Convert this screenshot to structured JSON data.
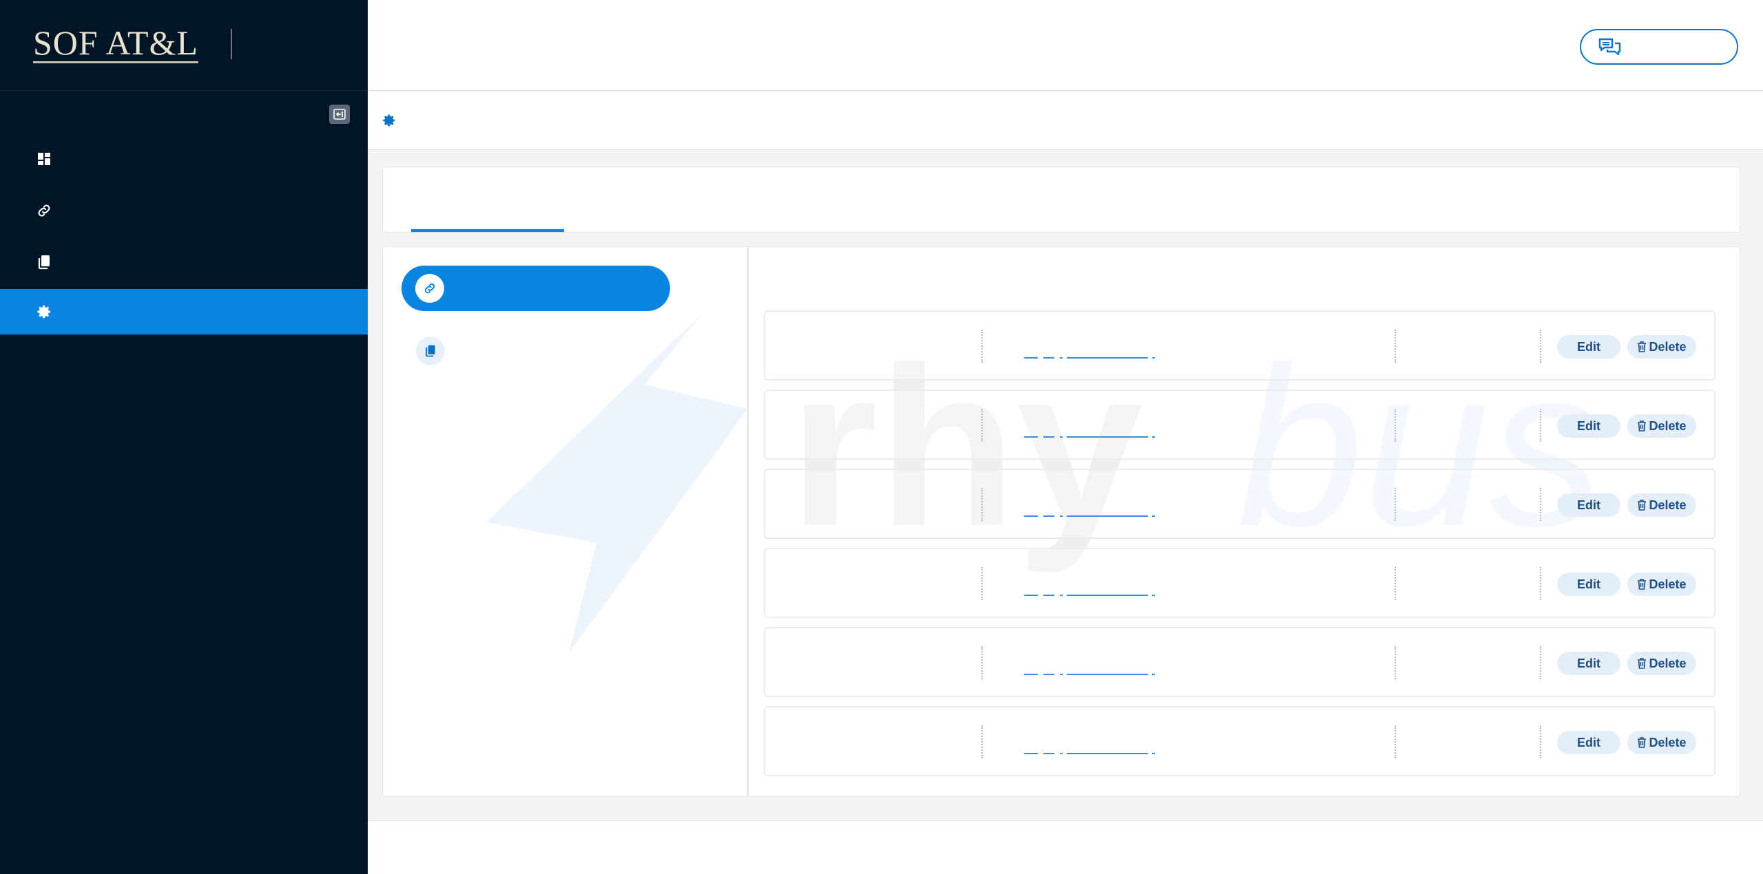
{
  "brand": {
    "logo_text": "SOF AT&L"
  },
  "sidebar": {
    "items": [
      {
        "icon": "dashboard-icon",
        "active": false
      },
      {
        "icon": "link-icon",
        "active": false
      },
      {
        "icon": "documents-icon",
        "active": false
      },
      {
        "icon": "gear-icon",
        "active": true
      }
    ]
  },
  "watermark": {
    "text_bold": "rhy",
    "text_light": "bus"
  },
  "table": {
    "rows": [
      {
        "edit_label": "Edit",
        "delete_label": "Delete"
      },
      {
        "edit_label": "Edit",
        "delete_label": "Delete"
      },
      {
        "edit_label": "Edit",
        "delete_label": "Delete"
      },
      {
        "edit_label": "Edit",
        "delete_label": "Delete"
      },
      {
        "edit_label": "Edit",
        "delete_label": "Delete"
      },
      {
        "edit_label": "Edit",
        "delete_label": "Delete"
      }
    ]
  },
  "colors": {
    "sidebar_bg": "#021526",
    "accent": "#0b84e0",
    "button_bg": "#e4eef9",
    "button_text": "#1e4f86"
  }
}
